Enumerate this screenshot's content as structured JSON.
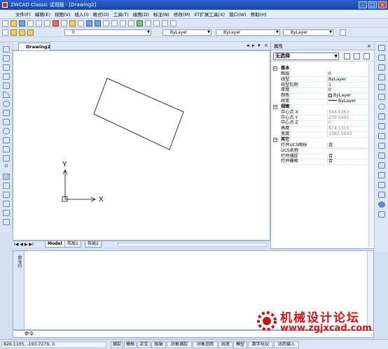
{
  "window": {
    "title": "ZWCAD Classic 试用版 - [Drawing2]"
  },
  "menu": [
    "文件(F)",
    "编辑(E)",
    "视图(V)",
    "插入(I)",
    "格式(O)",
    "工具(T)",
    "绘图(D)",
    "标注(N)",
    "修改(M)",
    "ET扩展工具(X)",
    "窗口(W)",
    "帮助(H)"
  ],
  "toolbar": {
    "layer_combo": "0",
    "color_combo": "ByLayer",
    "linetype_combo": "ByLayer",
    "lineweight_combo": "ByLayer"
  },
  "drawing": {
    "tab": "Drawing2",
    "ucs_x_label": "X",
    "ucs_y_label": "Y"
  },
  "layouts": {
    "nav": "I◀ ◀ ▶ ▶I",
    "tabs": [
      "Model",
      "布局1",
      "布局2"
    ]
  },
  "properties": {
    "header": "属性",
    "selection": "无选择",
    "rows": [
      {
        "type": "cat",
        "name": "基本"
      },
      {
        "type": "prop",
        "name": "图层",
        "value": "0"
      },
      {
        "type": "prop",
        "name": "线型",
        "value": "ByLayer"
      },
      {
        "type": "prop",
        "name": "线型比例",
        "value": "1"
      },
      {
        "type": "prop",
        "name": "厚度",
        "value": "0"
      },
      {
        "type": "prop",
        "name": "颜色",
        "value": "ByLayer",
        "swatch": true
      },
      {
        "type": "prop",
        "name": "线宽",
        "value": "ByLayer",
        "line": true
      },
      {
        "type": "cat",
        "name": "视图"
      },
      {
        "type": "prop",
        "name": "中心点 X",
        "value": "344.9363",
        "dim": true
      },
      {
        "type": "prop",
        "name": "中心点 Y",
        "value": "239.5455",
        "dim": true
      },
      {
        "type": "prop",
        "name": "中心点 Z",
        "value": "0",
        "dim": true
      },
      {
        "type": "prop",
        "name": "高度",
        "value": "874.1315",
        "dim": true
      },
      {
        "type": "prop",
        "name": "宽度",
        "value": "1382.5943",
        "dim": true
      },
      {
        "type": "cat",
        "name": "其它"
      },
      {
        "type": "prop",
        "name": "打开UCS图标",
        "value": "是"
      },
      {
        "type": "prop",
        "name": "UCS名称",
        "value": ""
      },
      {
        "type": "prop",
        "name": "打开捕捉",
        "value": "否"
      },
      {
        "type": "prop",
        "name": "打开栅格",
        "value": "否"
      }
    ]
  },
  "command": {
    "side_label": "命令行",
    "prompt": "命令:"
  },
  "watermark": {
    "text": "机械设计论坛",
    "url": "www.zgjxcad.com"
  },
  "status": {
    "coords": "826.1105, -193.7279, 0",
    "buttons": [
      "捕捉",
      "栅格",
      "正交",
      "极轴",
      "对象捕捉",
      "对象追踪",
      "线宽",
      "模型",
      "数字化仪",
      "动态输入"
    ]
  }
}
